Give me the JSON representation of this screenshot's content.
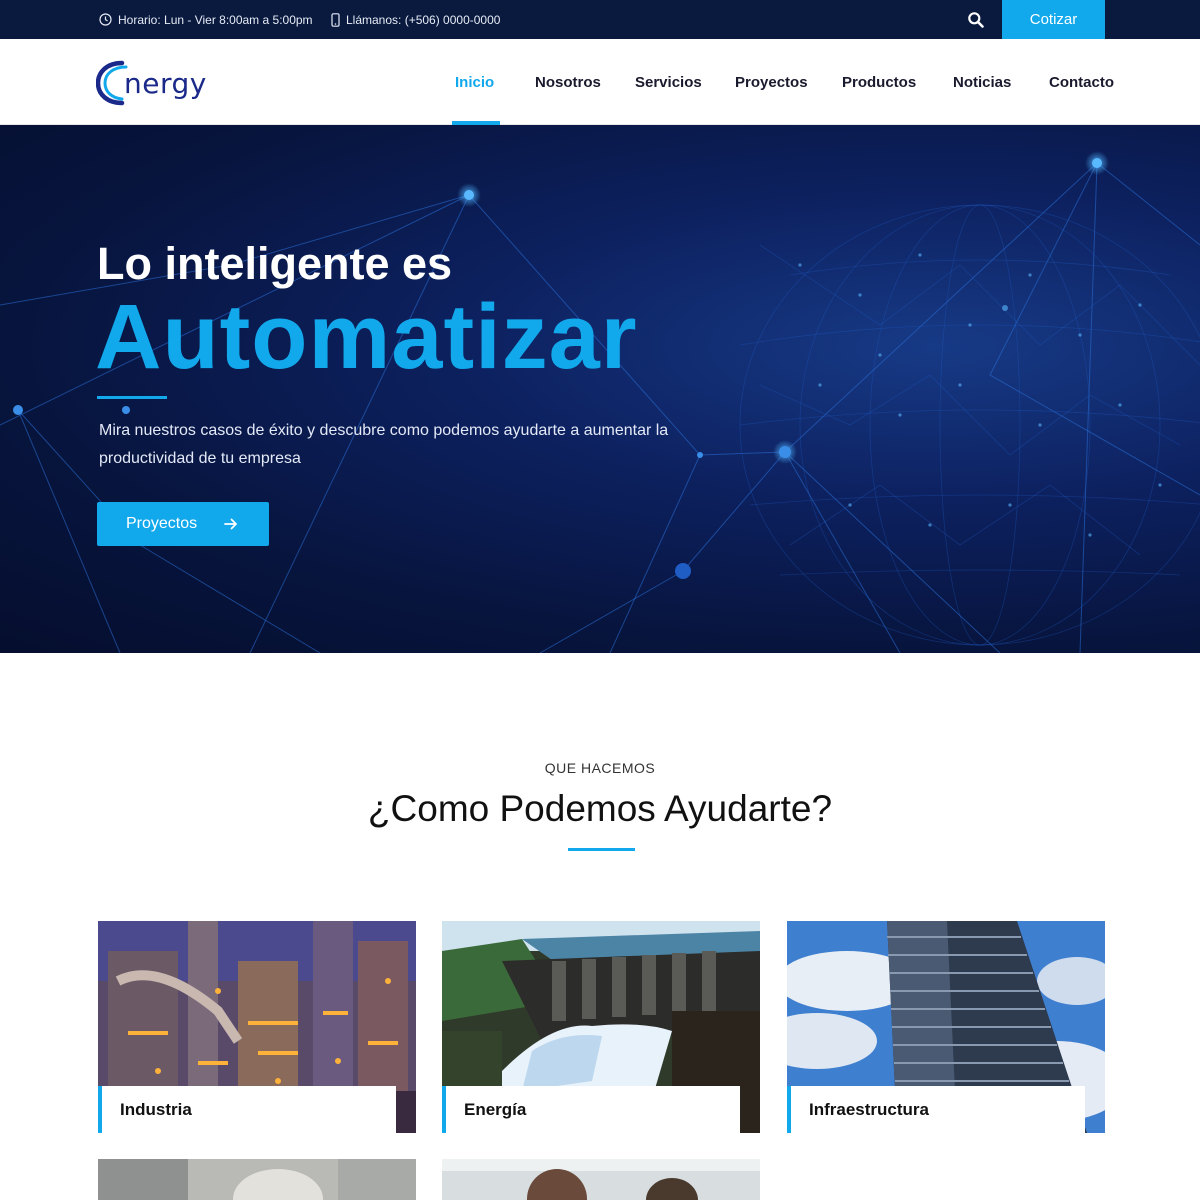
{
  "topbar": {
    "hours": "Horario: Lun - Vier  8:00am a 5:00pm",
    "phone": "Llámanos: (+506) 0000-0000",
    "search_icon": "search-icon",
    "cta_label": "Cotizar"
  },
  "brand": {
    "logo_text": "nergy"
  },
  "nav": {
    "items": [
      {
        "label": "Inicio",
        "active": true
      },
      {
        "label": "Nosotros"
      },
      {
        "label": "Servicios"
      },
      {
        "label": "Proyectos"
      },
      {
        "label": "Productos"
      },
      {
        "label": "Noticias"
      },
      {
        "label": "Contacto"
      }
    ]
  },
  "hero": {
    "title_line1": "Lo inteligente es",
    "title_line2": "Automatizar",
    "subtitle": "Mira nuestros casos de éxito y descubre como podemos ayudarte a aumentar la productividad de tu empresa",
    "button_label": "Proyectos",
    "button_icon": "arrow-right-icon"
  },
  "section": {
    "eyebrow": "QUE HACEMOS",
    "title": "¿Como Podemos Ayudarte?"
  },
  "cards": [
    {
      "label": "Industria"
    },
    {
      "label": "Energía"
    },
    {
      "label": "Infraestructura"
    }
  ],
  "colors": {
    "accent": "#12a8ec",
    "topbar_bg": "#0a1a3f",
    "hero_bg": "#07143d",
    "nav_text": "#1a1a2e"
  }
}
